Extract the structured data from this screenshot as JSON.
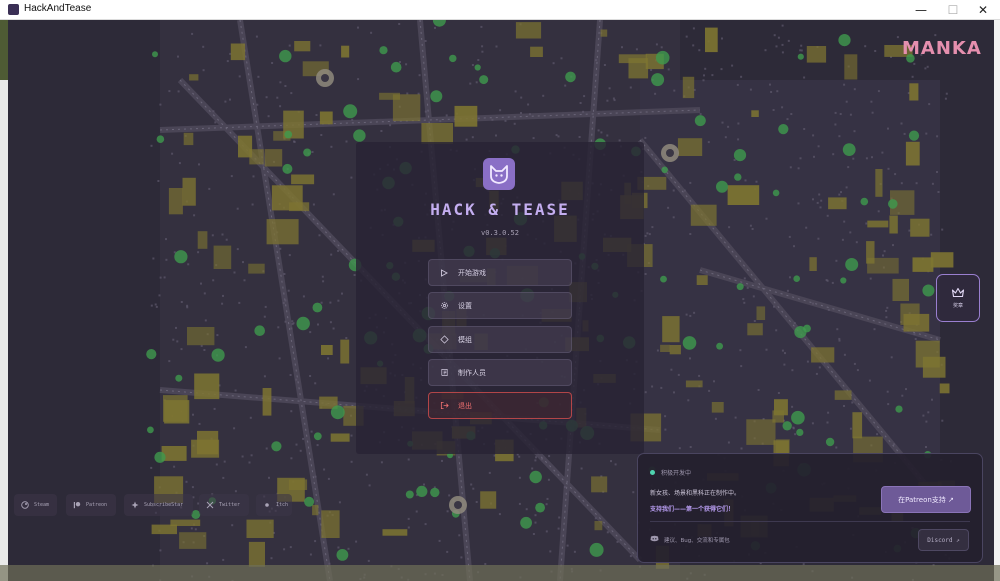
{
  "window": {
    "title": "HackAndTease",
    "minimize": "—",
    "maximize": "☐",
    "close": "✕"
  },
  "brand": {
    "logo_text": "MANKA"
  },
  "game": {
    "title": "HACK & TEASE",
    "version": "v0.3.0.52"
  },
  "menu": {
    "start_label": "开始游戏",
    "settings_label": "设置",
    "mods_label": "模组",
    "credits_label": "制作人员",
    "exit_label": "退出"
  },
  "side_button": {
    "label": "奖章"
  },
  "social": {
    "steam": "Steam",
    "patreon": "Patreon",
    "subscribestar": "SubscribeStar",
    "twitter": "Twitter",
    "itch": "Itch"
  },
  "dev_card": {
    "status": "积极开发中",
    "line1": "新女孩、场景和黑科正在制作中。",
    "line2": "支持我们——第一个获得它们！",
    "patreon_button": "在Patreon支持 ↗",
    "community_text": "建议、Bug、交流和专属包",
    "discord_button": "Discord ↗"
  },
  "colors": {
    "accent": "#8a6fc6",
    "title": "#c4aef0",
    "exit": "#f07070",
    "status_dot": "#4fd3b0",
    "brand": "#e58fae",
    "map_building": "#7e7531",
    "map_tree": "#3f9a4e"
  }
}
